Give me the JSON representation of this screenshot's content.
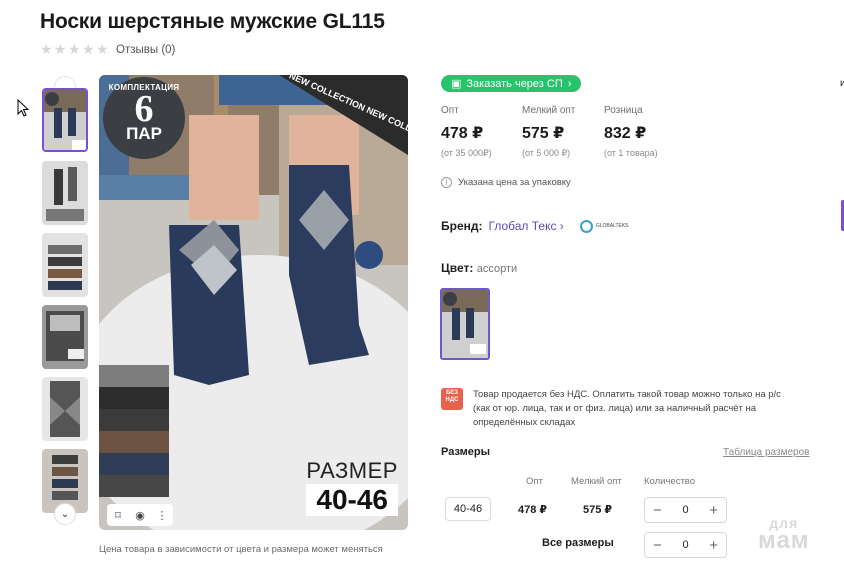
{
  "product": {
    "title": "Носки шерстяные мужские GL115",
    "reviews": "Отзывы (0)",
    "rating_stars": 0
  },
  "image": {
    "badge_top": "КОМПЛЕКТАЦИЯ",
    "badge_num": "6",
    "badge_word": "ПАР",
    "ribbon": "NEW COLLECTION NEW COLL",
    "size_label": "РАЗМЕР",
    "size_value": "40-46",
    "caption": "Цена товара в зависимости от цвета и размера может меняться"
  },
  "order_button": "Заказать через СП",
  "prices": [
    {
      "label": "Опт",
      "value": "478 ₽",
      "min": "(от 35 000₽)"
    },
    {
      "label": "Мелкий опт",
      "value": "575 ₽",
      "min": "(от 5 000 ₽)"
    },
    {
      "label": "Розница",
      "value": "832 ₽",
      "min": "(от 1 товара)"
    }
  ],
  "price_note": "Указана цена за упаковку",
  "brand": {
    "label": "Бренд:",
    "name": "Глобал Текс",
    "logo_text": "GLOBALTEKS"
  },
  "color": {
    "label": "Цвет:",
    "value": "ассорти"
  },
  "nds": {
    "badge": "БЕЗ НДС",
    "text": "Товар продается без НДС. Оплатить такой товар можно только на р/с (как от юр. лица, так и от физ. лица) или за наличный расчёт на определённых складах"
  },
  "sizes": {
    "heading": "Размеры",
    "table_link": "Таблица размеров",
    "columns": [
      "Опт",
      "Мелкий опт",
      "Количество"
    ],
    "rows": [
      {
        "size": "40-46",
        "opt": "478 ₽",
        "small_opt": "575 ₽",
        "qty": "0"
      }
    ],
    "all_label": "Все размеры",
    "all_qty": "0"
  },
  "watermark": {
    "top": "для",
    "bottom": "мам"
  },
  "colors": {
    "accent": "#7b4fd4",
    "order_green": "#27c46b",
    "nds_red": "#e8614c",
    "link": "#5c4bb7"
  }
}
